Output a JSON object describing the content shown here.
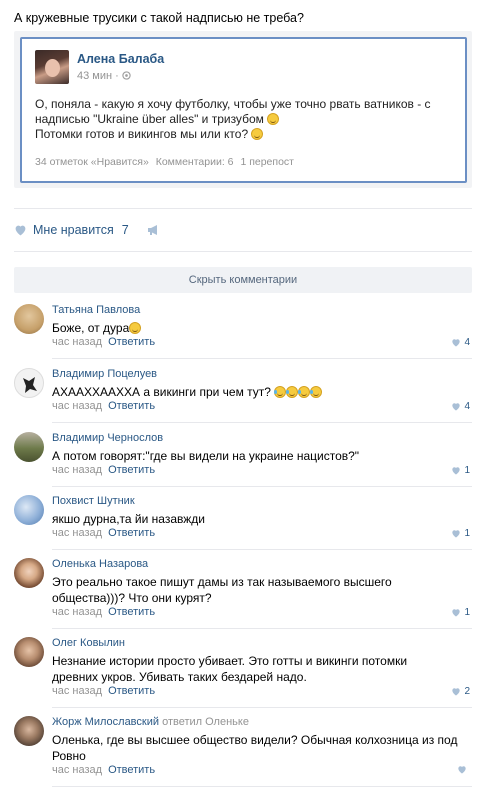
{
  "post": {
    "text": "А кружевные трусики с такой надписью не треба?"
  },
  "repost": {
    "author": "Алена Балаба",
    "time": "43 мин",
    "lines": [
      "О, поняла - какую я хочу футболку, чтобы уже точно рвать ватников - с",
      "надписью \"Ukraine über alles\" и тризубом",
      "Потомки готов и викингов мы или кто?"
    ],
    "stats": {
      "likes": "34 отметок «Нравится»",
      "comments": "Комментарии: 6",
      "reposts": "1 перепост"
    }
  },
  "like_bar": {
    "label": "Мне нравится",
    "count": "7"
  },
  "hide_comments_label": "Скрыть комментарии",
  "comments": [
    {
      "author": "Татьяна Павлова",
      "reply_to": "",
      "lines": [
        "Боже, от дура"
      ],
      "time": "час назад",
      "reply_label": "Ответить",
      "likes": "4",
      "avatar_color": "#d9b98a"
    },
    {
      "author": "Владимир Поцелуев",
      "reply_to": "",
      "lines": [
        "АХААХХААХХА а викинги при чем тут?"
      ],
      "time": "час назад",
      "reply_label": "Ответить",
      "likes": "4",
      "avatar_color": "#e8e8e8"
    },
    {
      "author": "Владимир Чернослов",
      "reply_to": "",
      "lines": [
        "А потом говорят:\"где вы видели на украине нацистов?\""
      ],
      "time": "час назад",
      "reply_label": "Ответить",
      "likes": "1",
      "avatar_color": "#7c8a5a"
    },
    {
      "author": "Похвист Шутник",
      "reply_to": "",
      "lines": [
        "якшо дурна,та йи назавжди"
      ],
      "time": "час назад",
      "reply_label": "Ответить",
      "likes": "1",
      "avatar_color": "#8fb0d8"
    },
    {
      "author": "Оленька Назарова",
      "reply_to": "",
      "lines": [
        "Это реально такое пишут дамы из так называемого высшего",
        "общества)))? Что они курят?"
      ],
      "time": "час назад",
      "reply_label": "Ответить",
      "likes": "1",
      "avatar_color": "#c89a7a"
    },
    {
      "author": "Олег Ковылин",
      "reply_to": "",
      "lines": [
        "Незнание истории просто убивает. Это готты и викинги потомки",
        "древних укров. Убивать таких бездарей надо."
      ],
      "time": "час назад",
      "reply_label": "Ответить",
      "likes": "2",
      "avatar_color": "#a0806a"
    },
    {
      "author": "Жорж Милославский",
      "reply_to": "ответил Оленьке",
      "lines": [
        "Оленька, где вы высшее общество видели? Обычная колхозница из под",
        "Ровно"
      ],
      "time": "час назад",
      "reply_label": "Ответить",
      "likes": "",
      "avatar_color": "#6a5a4a"
    }
  ]
}
